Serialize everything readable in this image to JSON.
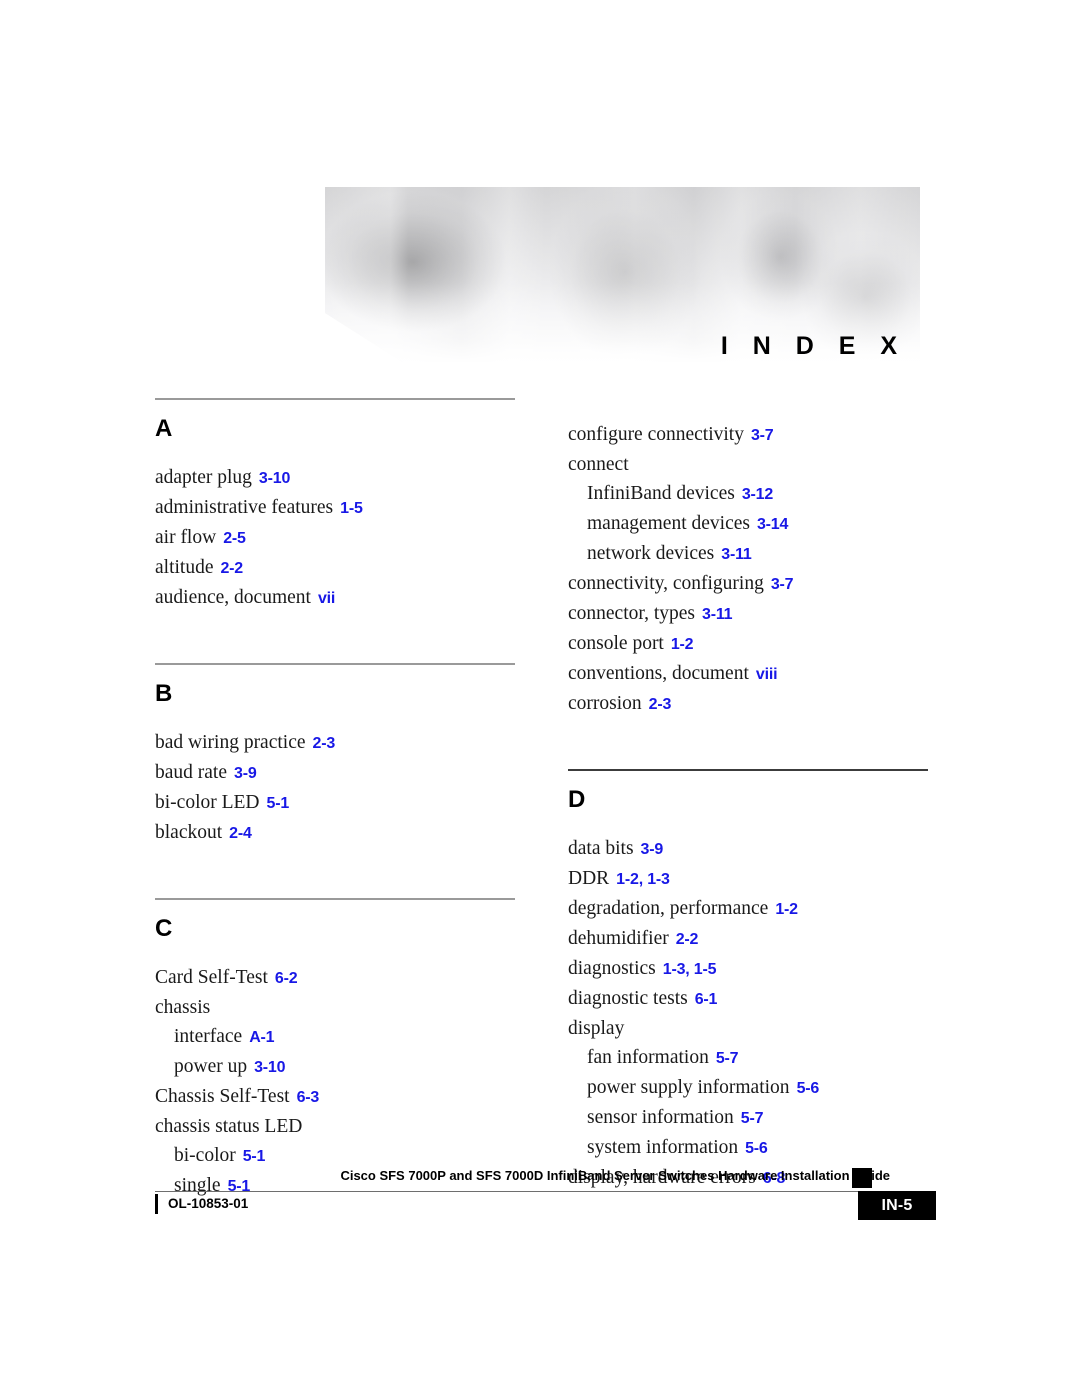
{
  "banner": {
    "title": "I N D E X",
    "image_name": "cisco-people-collage-grayscale"
  },
  "colors": {
    "page_reference_blue": "#1818e6",
    "section_rule_gray": "#9a9a9a",
    "text_black": "#1a1a1a",
    "footer_tab_bg": "#000000"
  },
  "columns": [
    {
      "id": "left",
      "sections": [
        {
          "letter": "A",
          "entries": [
            {
              "term": "adapter plug",
              "refs": "3-10",
              "level": 0
            },
            {
              "term": "administrative features",
              "refs": "1-5",
              "level": 0
            },
            {
              "term": "air flow",
              "refs": "2-5",
              "level": 0
            },
            {
              "term": "altitude",
              "refs": "2-2",
              "level": 0
            },
            {
              "term": "audience, document",
              "refs": "vii",
              "level": 0
            }
          ]
        },
        {
          "letter": "B",
          "entries": [
            {
              "term": "bad wiring practice",
              "refs": "2-3",
              "level": 0
            },
            {
              "term": "baud rate",
              "refs": "3-9",
              "level": 0
            },
            {
              "term": "bi-color LED",
              "refs": "5-1",
              "level": 0
            },
            {
              "term": "blackout",
              "refs": "2-4",
              "level": 0
            }
          ]
        },
        {
          "letter": "C",
          "entries": [
            {
              "term": "Card Self-Test",
              "refs": "6-2",
              "level": 0
            },
            {
              "term": "chassis",
              "refs": "",
              "level": 0
            },
            {
              "term": "interface",
              "refs": "A-1",
              "level": 1
            },
            {
              "term": "power up",
              "refs": "3-10",
              "level": 1
            },
            {
              "term": "Chassis Self-Test",
              "refs": "6-3",
              "level": 0
            },
            {
              "term": "chassis status LED",
              "refs": "",
              "level": 0
            },
            {
              "term": "bi-color",
              "refs": "5-1",
              "level": 1
            },
            {
              "term": "single",
              "refs": "5-1",
              "level": 1
            }
          ]
        }
      ]
    },
    {
      "id": "right",
      "sections": [
        {
          "letter": "",
          "entries": [
            {
              "term": "configure connectivity",
              "refs": "3-7",
              "level": 0
            },
            {
              "term": "connect",
              "refs": "",
              "level": 0
            },
            {
              "term": "InfiniBand devices",
              "refs": "3-12",
              "level": 1
            },
            {
              "term": "management devices",
              "refs": "3-14",
              "level": 1
            },
            {
              "term": "network devices",
              "refs": "3-11",
              "level": 1
            },
            {
              "term": "connectivity, configuring",
              "refs": "3-7",
              "level": 0
            },
            {
              "term": "connector, types",
              "refs": "3-11",
              "level": 0
            },
            {
              "term": "console port",
              "refs": "1-2",
              "level": 0
            },
            {
              "term": "conventions, document",
              "refs": "viii",
              "level": 0
            },
            {
              "term": "corrosion",
              "refs": "2-3",
              "level": 0
            }
          ]
        },
        {
          "letter": "D",
          "entries": [
            {
              "term": "data bits",
              "refs": "3-9",
              "level": 0
            },
            {
              "term": "DDR",
              "refs": "1-2, 1-3",
              "level": 0
            },
            {
              "term": "degradation, performance",
              "refs": "1-2",
              "level": 0
            },
            {
              "term": "dehumidifier",
              "refs": "2-2",
              "level": 0
            },
            {
              "term": "diagnostics",
              "refs": "1-3, 1-5",
              "level": 0
            },
            {
              "term": "diagnostic tests",
              "refs": "6-1",
              "level": 0
            },
            {
              "term": "display",
              "refs": "",
              "level": 0
            },
            {
              "term": "fan information",
              "refs": "5-7",
              "level": 1
            },
            {
              "term": "power supply information",
              "refs": "5-6",
              "level": 1
            },
            {
              "term": "sensor information",
              "refs": "5-7",
              "level": 1
            },
            {
              "term": "system information",
              "refs": "5-6",
              "level": 1
            },
            {
              "term": "display, hardware errors",
              "refs": "6-8",
              "level": 0
            }
          ]
        }
      ]
    }
  ],
  "footer": {
    "guide_title": "Cisco SFS 7000P and SFS 7000D InfiniBand Server Switches Hardware Installation Guide",
    "doc_number": "OL-10853-01",
    "page_tab": "IN-5"
  }
}
